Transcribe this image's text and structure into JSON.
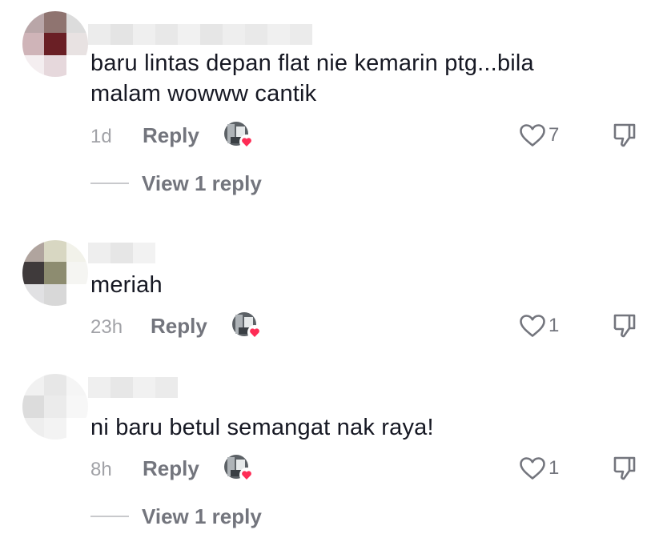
{
  "comments": [
    {
      "text_lines": [
        "baru lintas depan flat nie kemarin ptg...bila",
        "malam wowww cantik"
      ],
      "time": "1d",
      "reply_label": "Reply",
      "like_count": "7",
      "view_replies": "View 1 reply"
    },
    {
      "text_lines": [
        "meriah"
      ],
      "time": "23h",
      "reply_label": "Reply",
      "like_count": "1"
    },
    {
      "text_lines": [
        "ni baru betul semangat nak raya!"
      ],
      "time": "8h",
      "reply_label": "Reply",
      "like_count": "1",
      "view_replies": "View 1 reply"
    }
  ],
  "icons": {
    "like": "heart-outline-icon",
    "dislike": "thumbs-down-icon",
    "creator_liked": "creator-liked-avatar-icon"
  },
  "colors": {
    "text": "#161823",
    "muted": "#73757d",
    "time": "#a1a2a7",
    "heart_badge": "#fe2c55"
  }
}
